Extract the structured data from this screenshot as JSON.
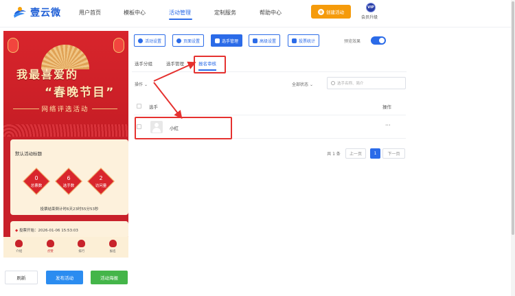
{
  "app": {
    "logo_text": "壹云微"
  },
  "nav": {
    "items": [
      {
        "label": "用户首页"
      },
      {
        "label": "模板中心"
      },
      {
        "label": "活动管理"
      },
      {
        "label": "定制服务"
      },
      {
        "label": "帮助中心"
      }
    ],
    "active_index": 2,
    "create_label": "创建活动",
    "vip_badge": "VIP",
    "vip_label": "会员升级"
  },
  "preview": {
    "title_line1": "我最喜爱的",
    "title_line2": "“春晚节目”",
    "subtitle": "网络评选活动",
    "activity_title": "默认活动标题",
    "stats": [
      {
        "value": "0",
        "label": "总票数"
      },
      {
        "value": "6",
        "label": "选手数"
      },
      {
        "value": "2",
        "label": "访问量"
      }
    ],
    "countdown": "投票结束倒计时6天23时55分53秒",
    "start_time": "投票开始：2026-01-06 15:53:03",
    "tabbar": [
      {
        "label": "介绍"
      },
      {
        "label": "点赞"
      },
      {
        "label": "排行"
      },
      {
        "label": "报名"
      }
    ]
  },
  "bottom_buttons": {
    "refresh": "刷新",
    "publish": "发布活动",
    "poster": "活动海报"
  },
  "toolbar": {
    "buttons": [
      {
        "label": "活动设置",
        "icon": "gear-icon"
      },
      {
        "label": "页面设置",
        "icon": "gear-icon"
      },
      {
        "label": "选手管理",
        "icon": "users-icon"
      },
      {
        "label": "高级设置",
        "icon": "sliders-icon"
      },
      {
        "label": "投票统计",
        "icon": "bar-chart-icon"
      }
    ],
    "active_index": 2,
    "preview_label": "预览效果",
    "preview_enabled": true
  },
  "subtabs": {
    "items": [
      {
        "label": "选手分组"
      },
      {
        "label": "选手管理"
      },
      {
        "label": "报名审核"
      }
    ],
    "active_index": 2
  },
  "filters": {
    "operation_label": "操作",
    "status_label": "全部状态",
    "search_placeholder": "选手名称、简介"
  },
  "table": {
    "headers": {
      "player": "选手",
      "operation": "操作"
    },
    "rows": [
      {
        "name": "小红",
        "action": "···"
      }
    ]
  },
  "pagination": {
    "total": "共 1 条",
    "prev": "上一页",
    "current": "1",
    "next": "下一页"
  },
  "colors": {
    "accent": "#2b6be8",
    "annotation": "#e5312f",
    "create_button": "#f59b0b",
    "publish_button": "#2b8cf0",
    "poster_button": "#44b549"
  }
}
